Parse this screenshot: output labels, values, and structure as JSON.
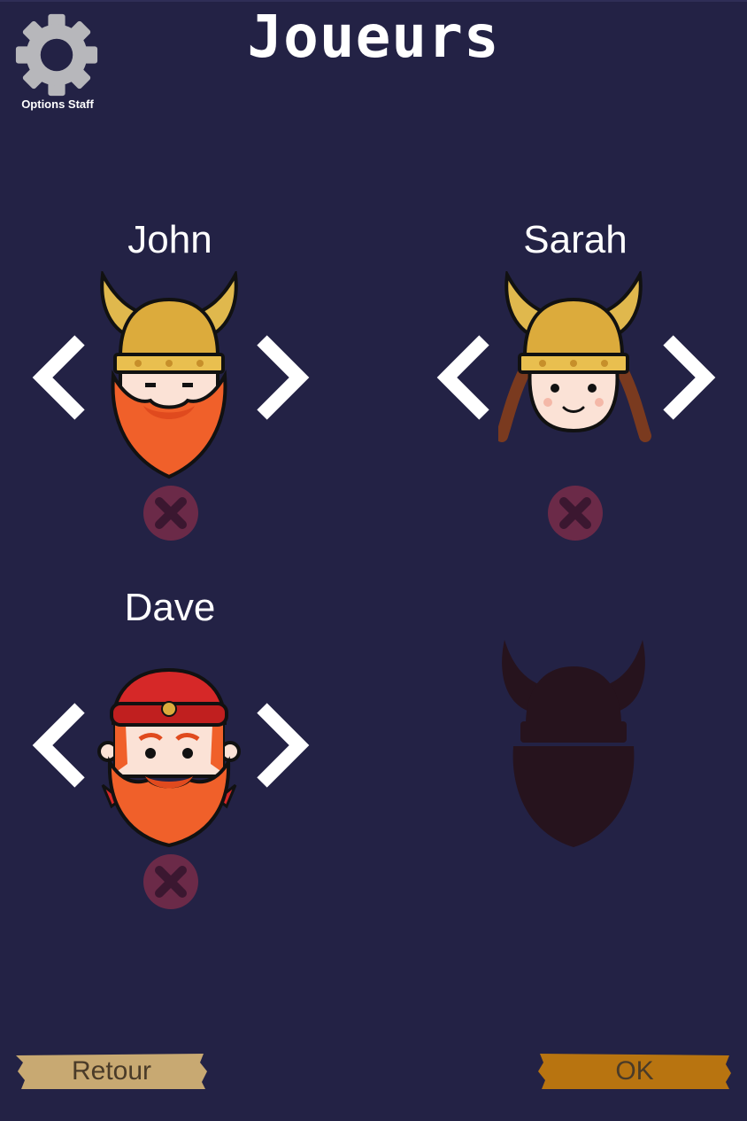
{
  "screen": {
    "title": "Joueurs"
  },
  "staff_options": {
    "label": "Options Staff",
    "icon": "gear-icon"
  },
  "players": [
    {
      "name": "John",
      "avatar": "viking-horned-helmet-bearded"
    },
    {
      "name": "Sarah",
      "avatar": "viking-horned-helmet-braids"
    },
    {
      "name": "Dave",
      "avatar": "viking-red-cap-bearded"
    }
  ],
  "empty_slot": {
    "avatar": "viking-silhouette"
  },
  "footer": {
    "back_label": "Retour",
    "ok_label": "OK"
  },
  "colors": {
    "background": "#232245",
    "remove_button": "#6b2a48",
    "back_button": "#c8a972",
    "ok_button": "#b87410",
    "silhouette": "#26131d"
  }
}
